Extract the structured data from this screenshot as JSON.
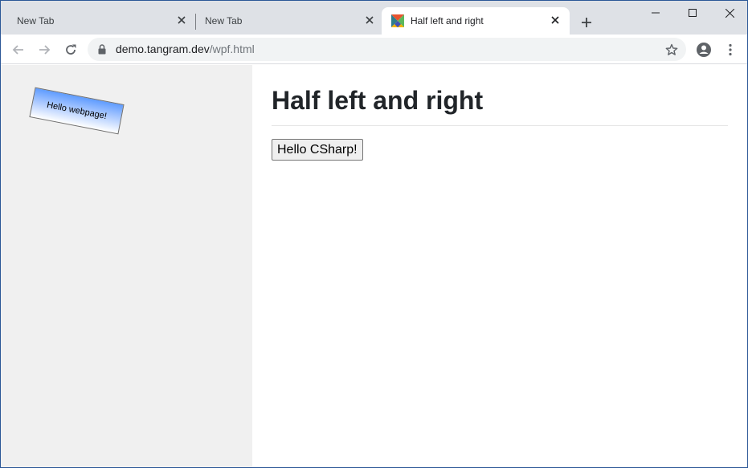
{
  "tabs": [
    {
      "title": "New Tab",
      "active": false
    },
    {
      "title": "New Tab",
      "active": false
    },
    {
      "title": "Half left and right",
      "active": true
    }
  ],
  "address_bar": {
    "host": "demo.tangram.dev",
    "path": "/wpf.html"
  },
  "left_pane": {
    "box_label": "Hello webpage!"
  },
  "page": {
    "heading": "Half left and right",
    "button_label": "Hello CSharp!"
  },
  "icons": {
    "tab_close": "close-icon",
    "new_tab": "plus-icon",
    "minimize": "minimize-icon",
    "maximize": "maximize-icon",
    "window_close": "close-icon",
    "back": "back-arrow-icon",
    "forward": "forward-arrow-icon",
    "reload": "reload-icon",
    "lock": "lock-icon",
    "bookmark": "star-icon",
    "profile": "account-circle-icon",
    "menu": "vertical-dots-icon"
  },
  "colors": {
    "tabstrip": "#dee1e6",
    "left_pane": "#f0f0f0",
    "window_border": "#2b5797",
    "heading": "#212529"
  }
}
